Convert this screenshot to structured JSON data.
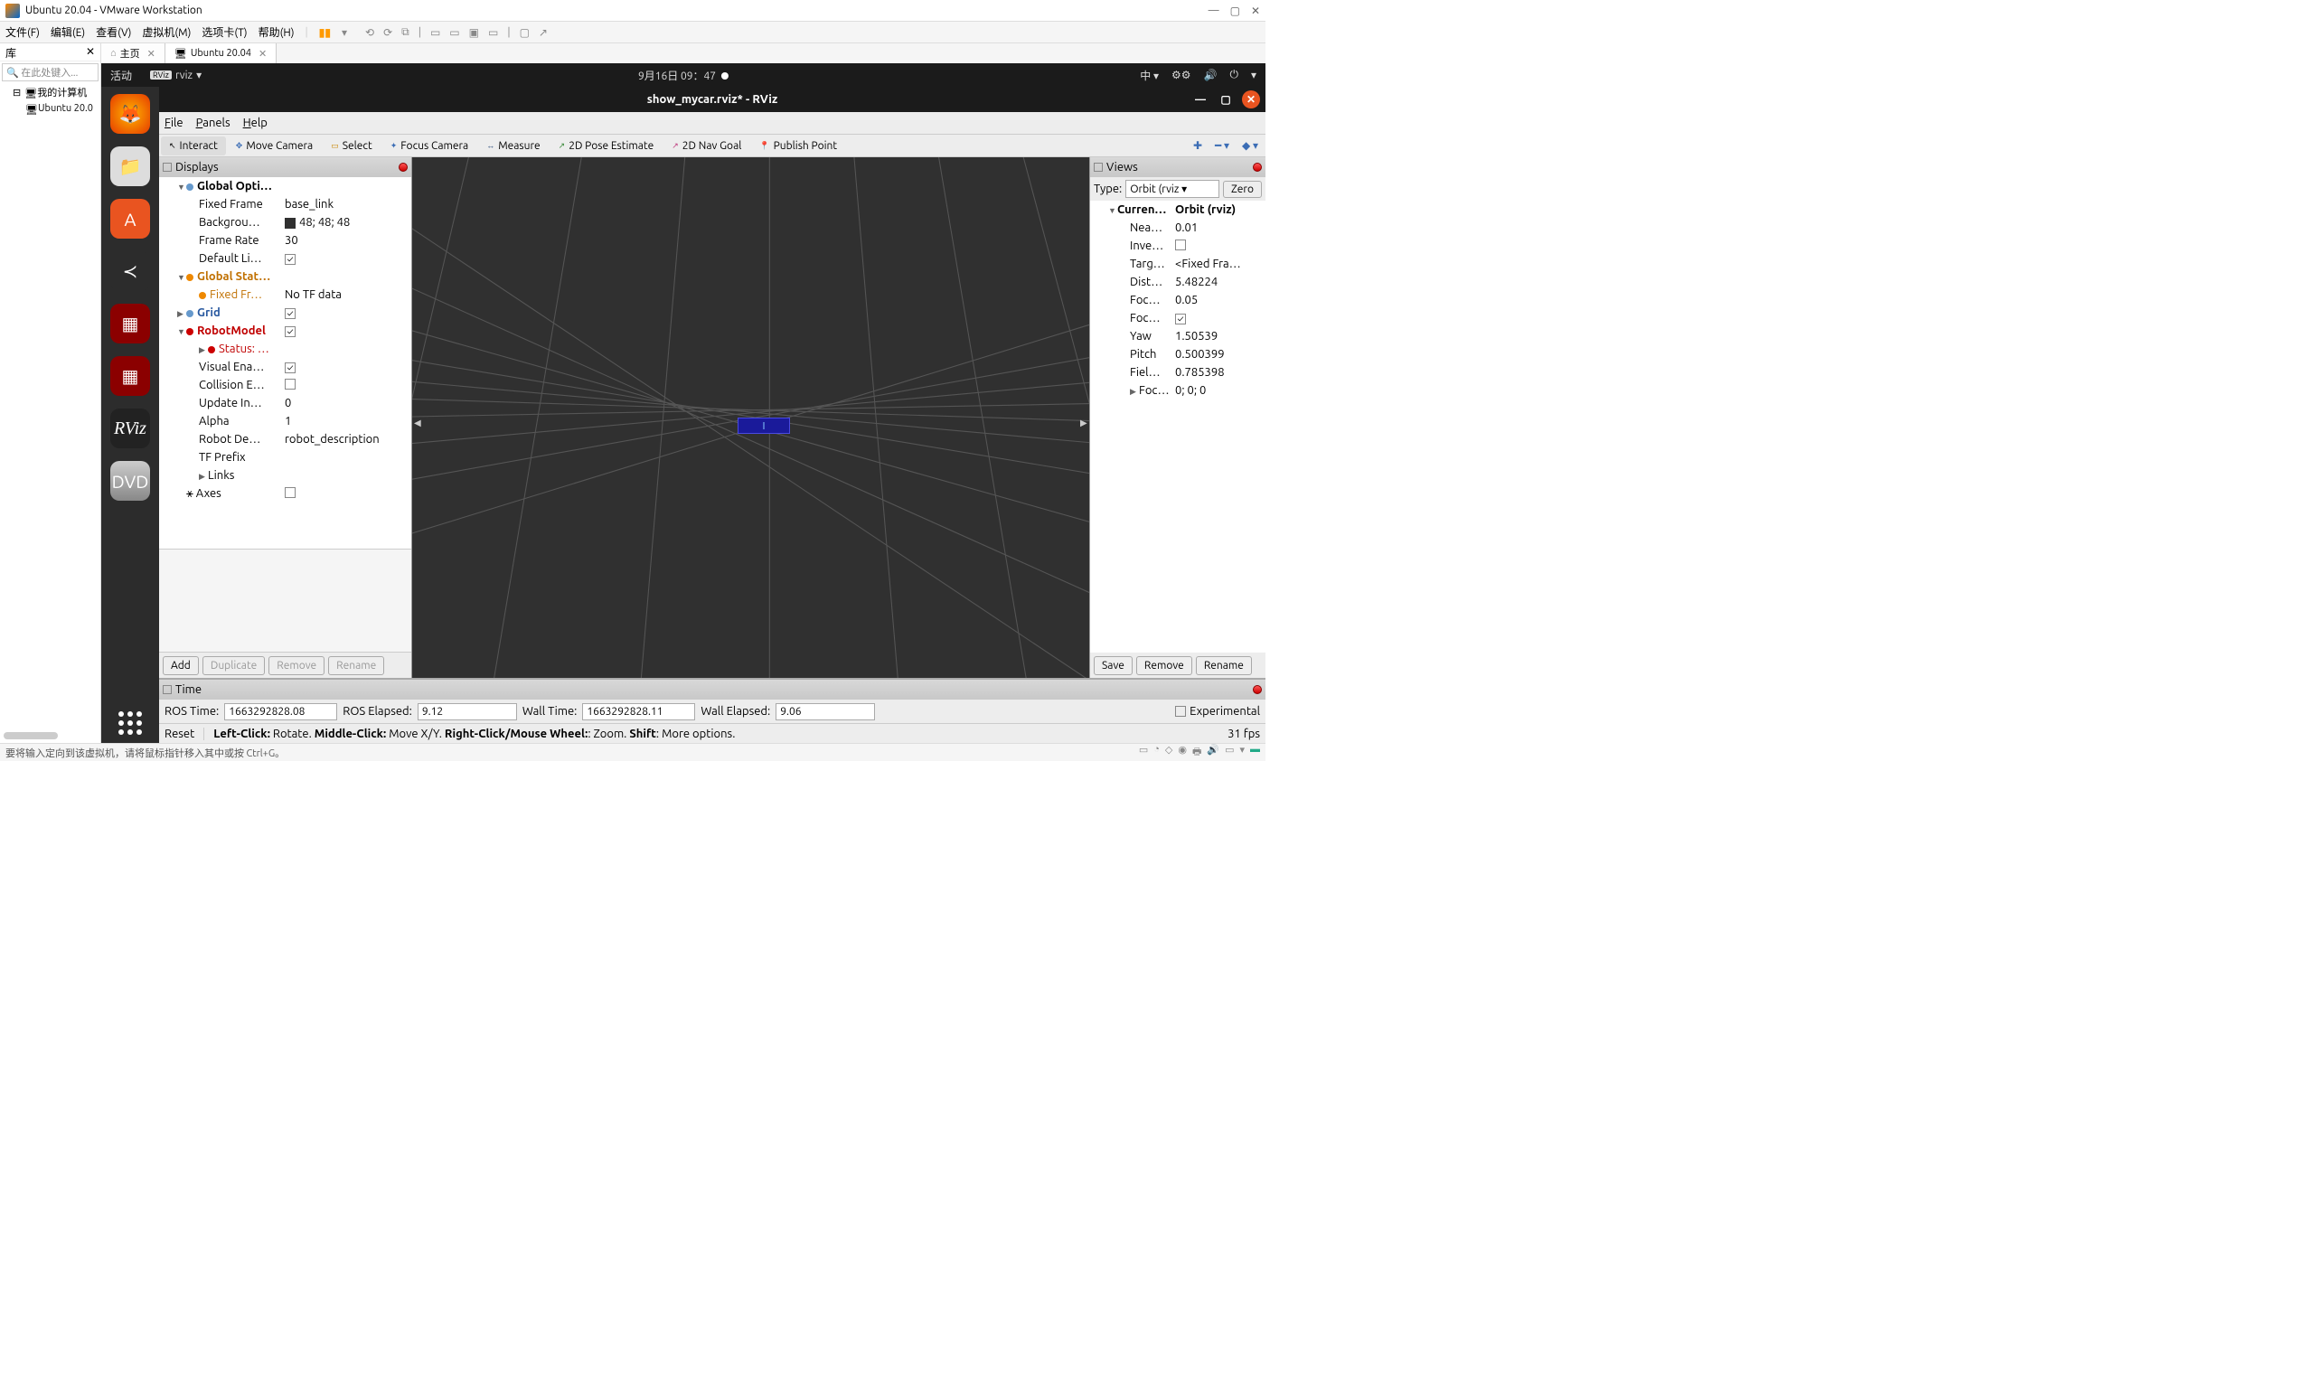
{
  "vmware": {
    "title": "Ubuntu 20.04 - VMware Workstation",
    "menu": [
      "文件(F)",
      "编辑(E)",
      "查看(V)",
      "虚拟机(M)",
      "选项卡(T)",
      "帮助(H)"
    ],
    "sidebar_title": "库",
    "search_placeholder": "在此处键入...",
    "tree_root": "我的计算机",
    "tree_child": "Ubuntu 20.0",
    "tabs": {
      "home": "主页",
      "vm": "Ubuntu 20.04"
    },
    "status": "要将输入定向到该虚拟机，请将鼠标指针移入其中或按 Ctrl+G。"
  },
  "ubuntu": {
    "activities": "活动",
    "appname": "rviz",
    "clock": "9月16日  09：47",
    "ime": "中"
  },
  "rviz": {
    "title": "show_mycar.rviz* - RViz",
    "menu": {
      "file": "File",
      "panels": "Panels",
      "help": "Help"
    },
    "toolbar": {
      "interact": "Interact",
      "move": "Move Camera",
      "select": "Select",
      "focus": "Focus Camera",
      "measure": "Measure",
      "pose": "2D Pose Estimate",
      "goal": "2D Nav Goal",
      "publish": "Publish Point"
    },
    "displays": {
      "title": "Displays",
      "global_opt": "Global Opti…",
      "fixed_frame_k": "Fixed Frame",
      "fixed_frame_v": "base_link",
      "background_k": "Backgrou…",
      "background_v": "48; 48; 48",
      "frame_rate_k": "Frame Rate",
      "frame_rate_v": "30",
      "default_light_k": "Default Li…",
      "global_status": "Global Stat…",
      "fixed_fr_k": "Fixed Fr…",
      "fixed_fr_v": "No TF data",
      "grid": "Grid",
      "robotmodel": "RobotModel",
      "status": "Status: …",
      "visual_k": "Visual Ena…",
      "collision_k": "Collision E…",
      "update_k": "Update In…",
      "update_v": "0",
      "alpha_k": "Alpha",
      "alpha_v": "1",
      "robotdesc_k": "Robot De…",
      "robotdesc_v": "robot_description",
      "tfprefix_k": "TF Prefix",
      "links": "Links",
      "axes": "Axes",
      "btn_add": "Add",
      "btn_dup": "Duplicate",
      "btn_rem": "Remove",
      "btn_ren": "Rename"
    },
    "views": {
      "title": "Views",
      "type_label": "Type:",
      "type_value": "Orbit (rviz",
      "zero": "Zero",
      "current": "Curren…",
      "current_v": "Orbit (rviz)",
      "near_k": "Nea…",
      "near_v": "0.01",
      "invert_k": "Inve…",
      "target_k": "Targ…",
      "target_v": "<Fixed Fra…",
      "dist_k": "Dist…",
      "dist_v": "5.48224",
      "focshape_k": "Foc…",
      "focshape_v": "0.05",
      "focfixed_k": "Foc…",
      "yaw_k": "Yaw",
      "yaw_v": "1.50539",
      "pitch_k": "Pitch",
      "pitch_v": "0.500399",
      "field_k": "Fiel…",
      "field_v": "0.785398",
      "focal_k": "Foc…",
      "focal_v": "0; 0; 0",
      "btn_save": "Save",
      "btn_remove": "Remove",
      "btn_rename": "Rename"
    },
    "time": {
      "title": "Time",
      "ros_time_l": "ROS Time:",
      "ros_time_v": "1663292828.08",
      "ros_el_l": "ROS Elapsed:",
      "ros_el_v": "9.12",
      "wall_time_l": "Wall Time:",
      "wall_time_v": "1663292828.11",
      "wall_el_l": "Wall Elapsed:",
      "wall_el_v": "9.06",
      "experimental": "Experimental",
      "reset": "Reset",
      "hint_left": "Left-Click:",
      "hint_left_t": " Rotate. ",
      "hint_mid": "Middle-Click:",
      "hint_mid_t": " Move X/Y. ",
      "hint_right": "Right-Click/Mouse Wheel:",
      "hint_right_t": ": Zoom. ",
      "hint_shift": "Shift",
      "hint_shift_t": ": More options.",
      "fps": "31 fps"
    }
  }
}
